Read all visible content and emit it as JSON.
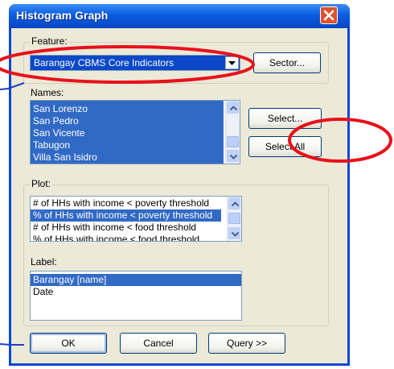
{
  "window": {
    "title": "Histogram Graph"
  },
  "feature": {
    "legend": "Feature:",
    "selected": "Barangay CBMS Core Indicators",
    "sector_button": "Sector..."
  },
  "names": {
    "label": "Names:",
    "items": [
      "San Lorenzo",
      "San Pedro",
      "San Vicente",
      "Tabugon",
      "Villa San Isidro"
    ],
    "select_button": "Select...",
    "select_all_button": "Select All"
  },
  "plot": {
    "legend": "Plot:",
    "items": [
      "# of HHs with income < poverty threshold",
      "% of HHs with income < poverty threshold",
      "# of HHs with income < food threshold",
      "% of HHs with income < food threshold"
    ],
    "label_caption": "Label:",
    "label_items": [
      "Barangay [name]",
      "Date"
    ]
  },
  "buttons": {
    "ok": "OK",
    "cancel": "Cancel",
    "query": "Query >>"
  },
  "colors": {
    "annotation_red": "#e8101a",
    "annotation_blue": "#1f3fbf",
    "selection": "#316ac5",
    "titlebar": "#0a5de0"
  }
}
